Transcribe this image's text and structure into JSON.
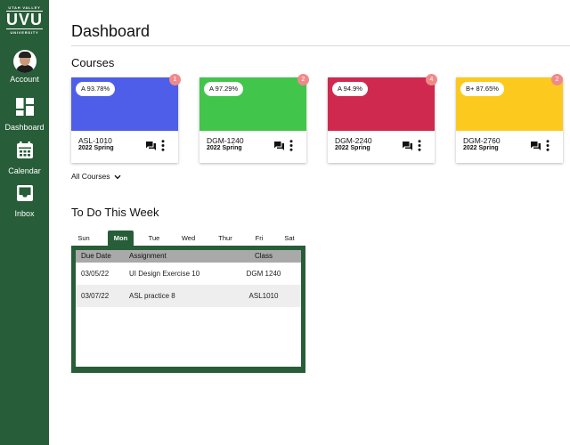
{
  "sidebar": {
    "logo": {
      "top_text": "UTAH VALLEY",
      "mark": "UVU",
      "bottom_text": "UNIVERSITY"
    },
    "items": [
      {
        "label": "Account",
        "icon": "avatar"
      },
      {
        "label": "Dashboard",
        "icon": "dashboard-icon"
      },
      {
        "label": "Calendar",
        "icon": "calendar-icon"
      },
      {
        "label": "Inbox",
        "icon": "inbox-icon"
      }
    ],
    "color": "#275d38"
  },
  "header": {
    "title": "Dashboard"
  },
  "courses": {
    "title": "Courses",
    "cards": [
      {
        "grade": "A 93.78%",
        "count": "1",
        "code": "ASL-1010",
        "term": "2022 Spring",
        "color": "#4f5ee8"
      },
      {
        "grade": "A 97.29%",
        "count": "2",
        "code": "DGM-1240",
        "term": "2022 Spring",
        "color": "#42c54b"
      },
      {
        "grade": "A 94.9%",
        "count": "4",
        "code": "DGM-2240",
        "term": "2022 Spring",
        "color": "#d0294f"
      },
      {
        "grade": "B+ 87.65%",
        "count": "2",
        "code": "DGM-2760",
        "term": "2022 Spring",
        "color": "#fcca1e"
      }
    ],
    "all_courses_label": "All Courses"
  },
  "todo": {
    "title": "To Do This Week",
    "days": [
      "Sun",
      "Mon",
      "Tue",
      "Wed",
      "Thur",
      "Fri",
      "Sat"
    ],
    "active_day": "Mon",
    "columns": [
      "Due Date",
      "Assignment",
      "Class"
    ],
    "rows": [
      {
        "due": "03/05/22",
        "assignment": "UI Design Exercise 10",
        "class": "DGM 1240"
      },
      {
        "due": "03/07/22",
        "assignment": "ASL practice 8",
        "class": "ASL1010"
      }
    ]
  },
  "colors": {
    "brand_green": "#275d38",
    "badge": "#f08a8a",
    "table_header": "#a9a9a9"
  }
}
